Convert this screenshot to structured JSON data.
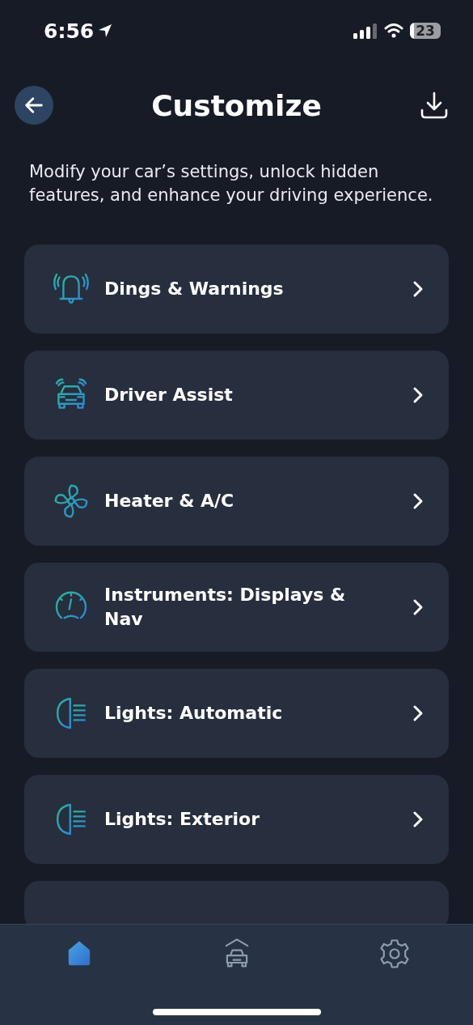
{
  "status_bar": {
    "time": "6:56",
    "battery": "23"
  },
  "header": {
    "title": "Customize"
  },
  "description": "Modify your car’s settings, unlock hidden features, and enhance your driving experience.",
  "items": [
    {
      "kind": "bell",
      "label": "Dings & Warnings"
    },
    {
      "kind": "car",
      "label": "Driver Assist"
    },
    {
      "kind": "fan",
      "label": "Heater & A/C"
    },
    {
      "kind": "gauge",
      "label": "Instruments: Displays & Nav"
    },
    {
      "kind": "light",
      "label": "Lights: Automatic"
    },
    {
      "kind": "light",
      "label": "Lights: Exterior"
    }
  ],
  "tab_bar": [
    {
      "kind": "home",
      "selected": true
    },
    {
      "kind": "garage",
      "selected": false
    },
    {
      "kind": "settings",
      "selected": false
    }
  ]
}
